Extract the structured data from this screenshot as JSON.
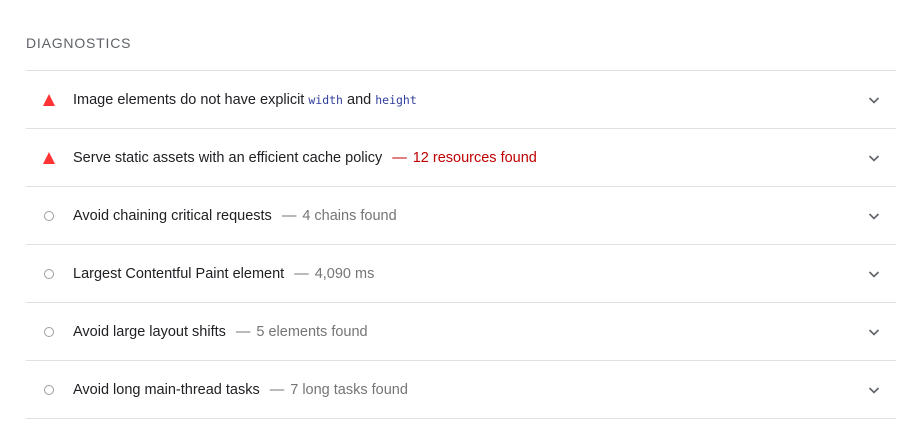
{
  "section": {
    "title": "DIAGNOSTICS"
  },
  "colors": {
    "fail": "#ff3333",
    "fail_text": "#c00000",
    "neutral_text": "#757575",
    "code": "#303f9f"
  },
  "audits": [
    {
      "status": "fail",
      "icon": "warning-triangle-icon",
      "title_before": "Image elements do not have explicit ",
      "code1": "width",
      "title_mid": " and ",
      "code2": "height",
      "separator": "",
      "display_value": ""
    },
    {
      "status": "fail",
      "icon": "warning-triangle-icon",
      "title": "Serve static assets with an efficient cache policy",
      "separator": "—",
      "display_value": "12 resources found"
    },
    {
      "status": "info",
      "icon": "info-circle-icon",
      "title": "Avoid chaining critical requests",
      "separator": "—",
      "display_value": "4 chains found"
    },
    {
      "status": "info",
      "icon": "info-circle-icon",
      "title": "Largest Contentful Paint element",
      "separator": "—",
      "display_value": "4,090 ms"
    },
    {
      "status": "info",
      "icon": "info-circle-icon",
      "title": "Avoid large layout shifts",
      "separator": "—",
      "display_value": "5 elements found"
    },
    {
      "status": "info",
      "icon": "info-circle-icon",
      "title": "Avoid long main-thread tasks",
      "separator": "—",
      "display_value": "7 long tasks found"
    }
  ]
}
